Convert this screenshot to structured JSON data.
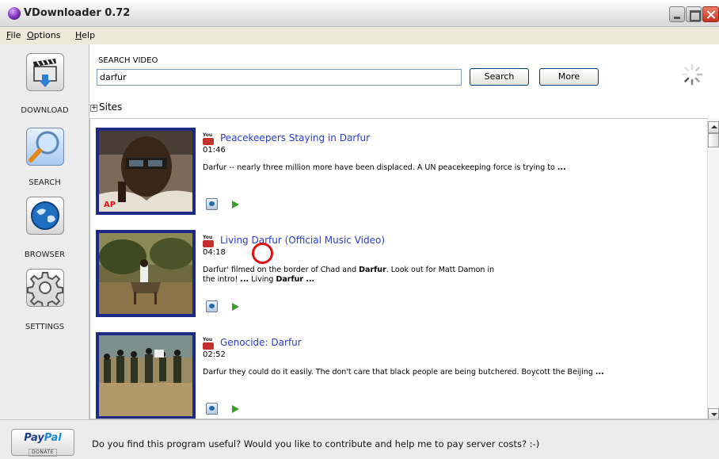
{
  "window": {
    "title": "VDownloader 0.72"
  },
  "menu": [
    {
      "label": "File",
      "u": "F",
      "rest": "ile"
    },
    {
      "label": "Options",
      "u": "O",
      "rest": "ptions"
    },
    {
      "label": "Help",
      "u": "H",
      "rest": "elp"
    }
  ],
  "sidebar": {
    "items": [
      {
        "label": "DOWNLOAD",
        "icon": "clapperboard-download-icon"
      },
      {
        "label": "SEARCH",
        "icon": "magnifier-icon"
      },
      {
        "label": "BROWSER",
        "icon": "globe-icon"
      },
      {
        "label": "SETTINGS",
        "icon": "gear-icon"
      }
    ]
  },
  "search": {
    "label": "SEARCH VIDEO",
    "value": "darfur",
    "search_button": "Search",
    "more_button": "More"
  },
  "sites": {
    "toggle": "⊞",
    "label": "Sites"
  },
  "results": [
    {
      "source_badge": "You",
      "title": "Peacekeepers Staying in Darfur",
      "duration": "01:46",
      "desc_parts": [
        "Darfur -- nearly three million more have been displaced. A UN peacekeeping force is trying to ",
        "..."
      ],
      "desc_plain": "Darfur -- nearly three million more have been displaced. A UN peacekeeping force is trying to",
      "desc_bold": "..."
    },
    {
      "source_badge": "You",
      "title": "Living Darfur (Official Music Video)",
      "duration": "04:18",
      "desc_1": "Darfur' filmed on the border of Chad and ",
      "desc_1b": "Darfur",
      "desc_2": ". Look out for Matt Damon in the intro! ",
      "desc_2b": "...",
      "desc_3": " Living ",
      "desc_3b": "Darfur ..."
    },
    {
      "source_badge": "You",
      "title": "Genocide: Darfur",
      "duration": "02:52",
      "desc_plain": "Darfur they could do it easily. The don't care that black people are being butchered. Boycott the Beijing ",
      "desc_bold": "..."
    }
  ],
  "footer": {
    "paypal_pay": "Pay",
    "paypal_pal": "Pal",
    "paypal_donate": "DONATE",
    "message": "Do you find this program useful? Would you like to contribute and help me to pay server costs? :-)"
  },
  "colors": {
    "title_link": "#2b3ec9",
    "thumb_border": "#1c2a86",
    "youtube_red": "#c4302b",
    "play_green": "#3aa02b",
    "cursor_ring": "#d81212"
  }
}
